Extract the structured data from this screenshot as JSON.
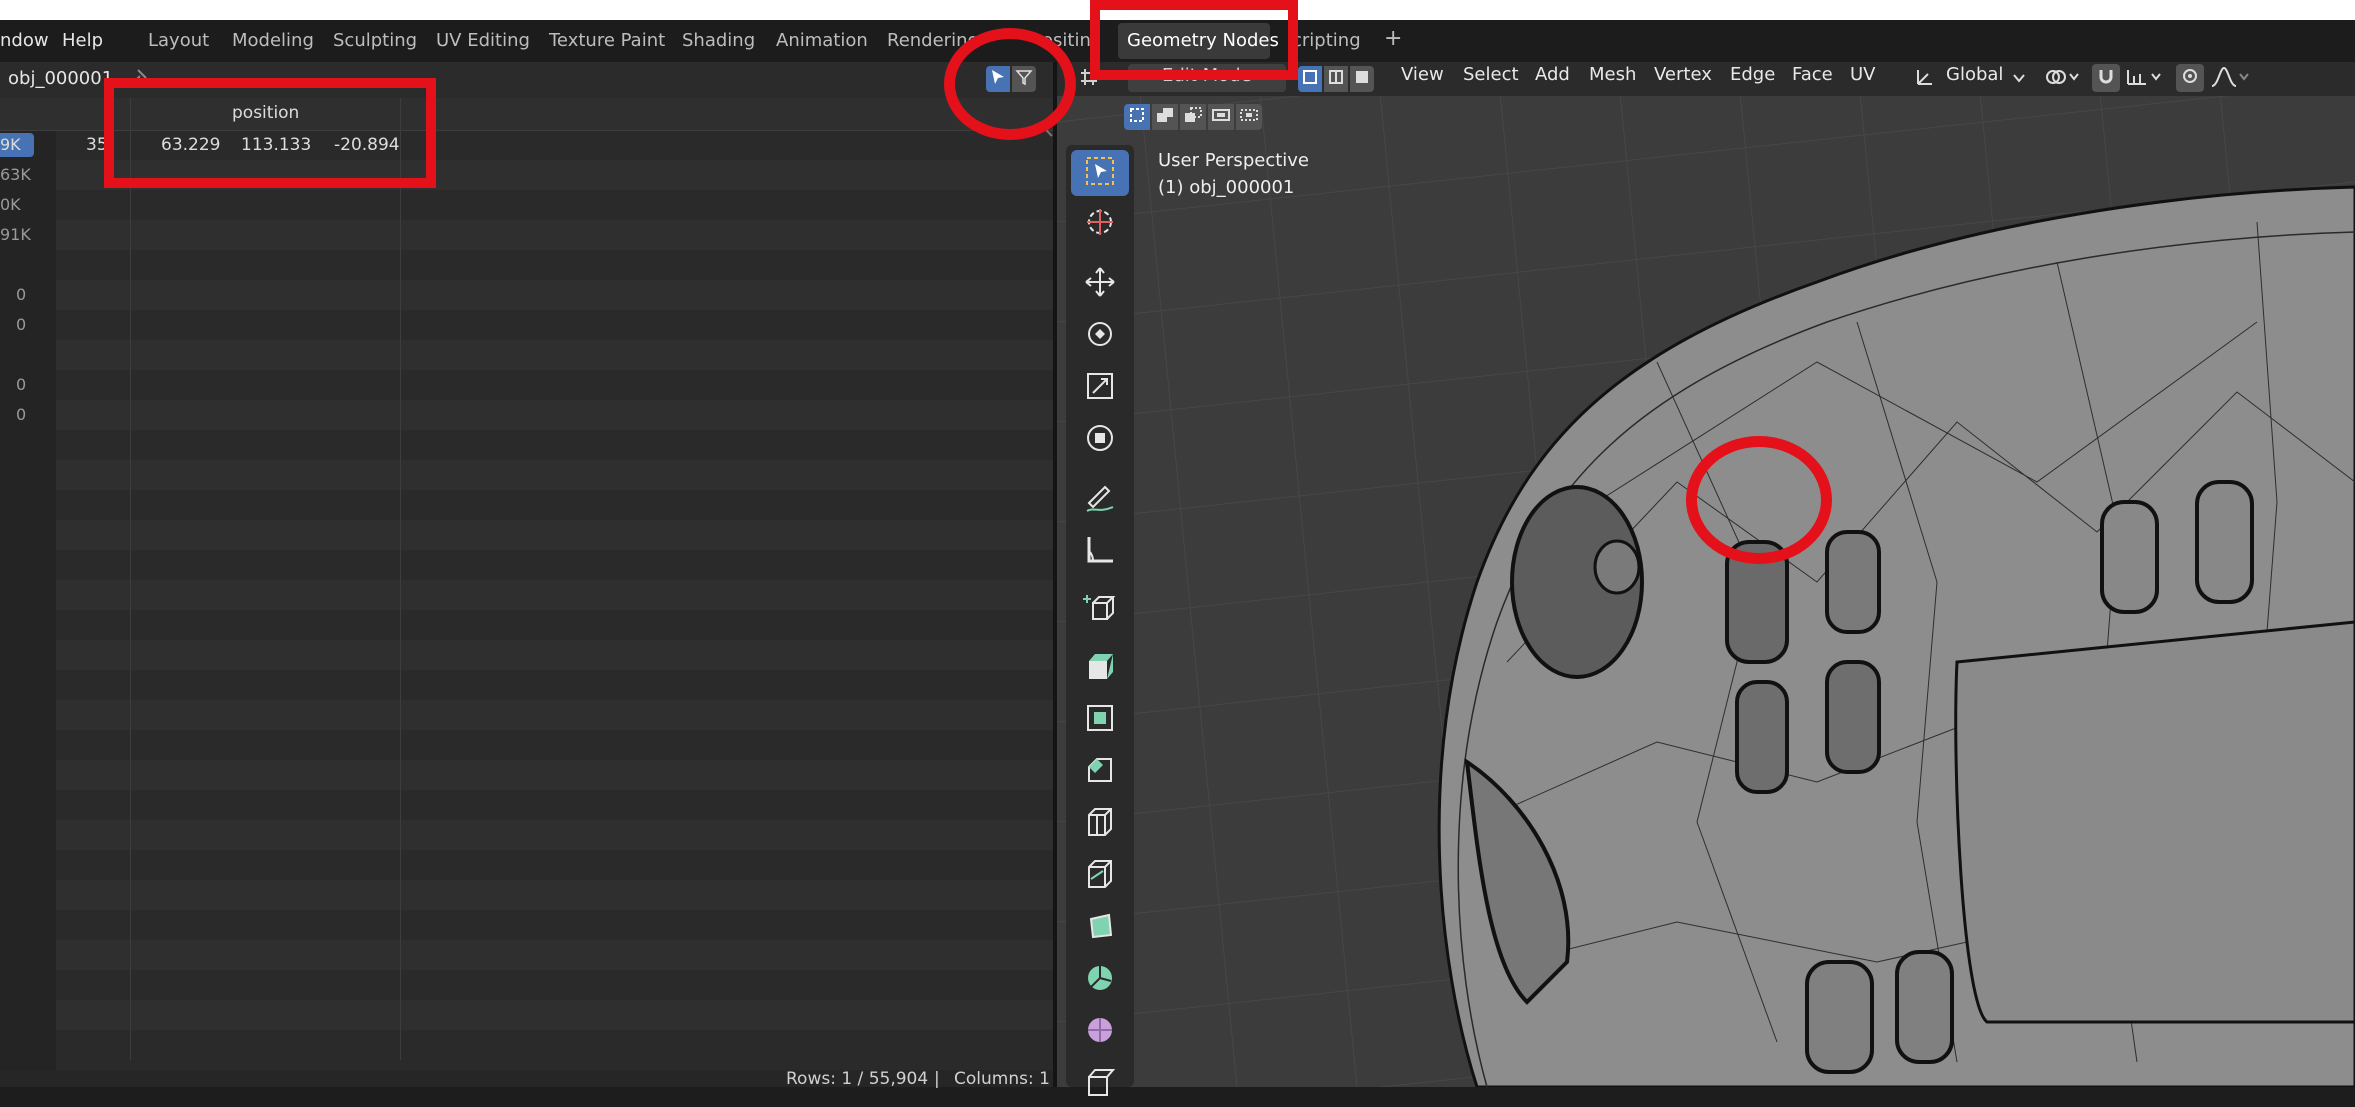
{
  "menu": {
    "window": "ndow",
    "help": "Help"
  },
  "workspaces": [
    {
      "label": "Layout"
    },
    {
      "label": "Modeling"
    },
    {
      "label": "Sculpting"
    },
    {
      "label": "UV Editing"
    },
    {
      "label": "Texture Paint"
    },
    {
      "label": "Shading"
    },
    {
      "label": "Animation"
    },
    {
      "label": "Rendering"
    },
    {
      "label": "ositin"
    },
    {
      "label": "Geometry Nodes"
    },
    {
      "label": "cripting"
    }
  ],
  "add_workspace": "+",
  "spreadsheet": {
    "object_name": "obj_000001",
    "column_header": "position",
    "row_index": "35",
    "left_counts": [
      "9K",
      "63K",
      "0K",
      "91K",
      "0",
      "0",
      "0",
      "0"
    ],
    "row": {
      "x": "63.229",
      "y": "113.133",
      "z": "-20.894"
    },
    "status_rows": "Rows: 1 / 55,904",
    "status_sep": "|",
    "status_cols": "Columns: 1"
  },
  "viewport": {
    "mode": "Edit Mode",
    "menus": [
      "View",
      "Select",
      "Add",
      "Mesh",
      "Vertex",
      "Edge",
      "Face",
      "UV"
    ],
    "orientation": "Global",
    "overlay_title": "User Perspective",
    "overlay_object": "(1) obj_000001"
  },
  "colors": {
    "accent": "#4772b3",
    "annotation": "#e4101a",
    "tool_green": "#7fd3b0"
  }
}
